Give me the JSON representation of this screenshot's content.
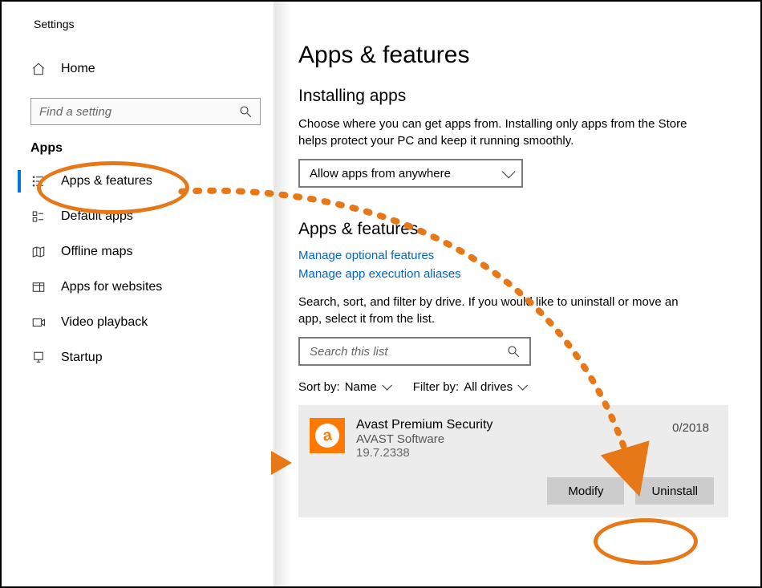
{
  "window_title": "Settings",
  "sidebar": {
    "home": "Home",
    "search_placeholder": "Find a setting",
    "section": "Apps",
    "items": [
      {
        "id": "apps-features",
        "label": "Apps & features",
        "active": true
      },
      {
        "id": "default-apps",
        "label": "Default apps",
        "active": false
      },
      {
        "id": "offline-maps",
        "label": "Offline maps",
        "active": false
      },
      {
        "id": "apps-websites",
        "label": "Apps for websites",
        "active": false
      },
      {
        "id": "video-playback",
        "label": "Video playback",
        "active": false
      },
      {
        "id": "startup",
        "label": "Startup",
        "active": false
      }
    ]
  },
  "main": {
    "title": "Apps & features",
    "installing_heading": "Installing apps",
    "installing_desc": "Choose where you can get apps from. Installing only apps from the Store helps protect your PC and keep it running smoothly.",
    "install_dropdown": "Allow apps from anywhere",
    "apps_heading": "Apps & features",
    "link_optional": "Manage optional features",
    "link_aliases": "Manage app execution aliases",
    "search_desc": "Search, sort, and filter by drive. If you would like to uninstall or move an app, select it from the list.",
    "search_placeholder": "Search this list",
    "sort_label": "Sort by:",
    "sort_value": "Name",
    "filter_label": "Filter by:",
    "filter_value": "All drives",
    "app": {
      "name": "Avast Premium Security",
      "publisher": "AVAST Software",
      "version": "19.7.2338",
      "date_fragment": "0/2018",
      "modify": "Modify",
      "uninstall": "Uninstall"
    }
  }
}
